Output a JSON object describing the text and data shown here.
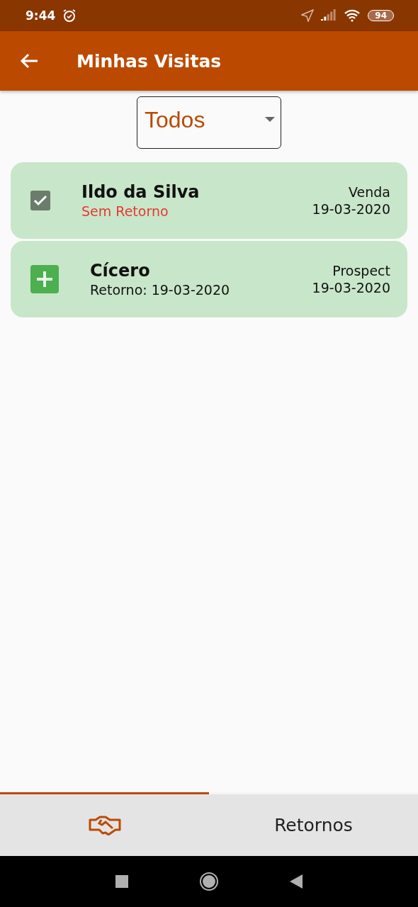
{
  "status_bar": {
    "time": "9:44",
    "battery": "94"
  },
  "app_bar": {
    "title": "Minhas Visitas"
  },
  "filter": {
    "value": "Todos"
  },
  "visits": [
    {
      "kind": "done",
      "name": "Ildo da Silva",
      "subtitle": "Sem Retorno",
      "alert": true,
      "type": "Venda",
      "date": "19-03-2020"
    },
    {
      "kind": "new",
      "name": "Cícero",
      "subtitle": "Retorno: 19-03-2020",
      "alert": false,
      "type": "Prospect",
      "date": "19-03-2020"
    }
  ],
  "tabs": [
    {
      "kind": "icon",
      "selected": true
    },
    {
      "kind": "text",
      "label": "Retornos",
      "selected": false
    }
  ]
}
